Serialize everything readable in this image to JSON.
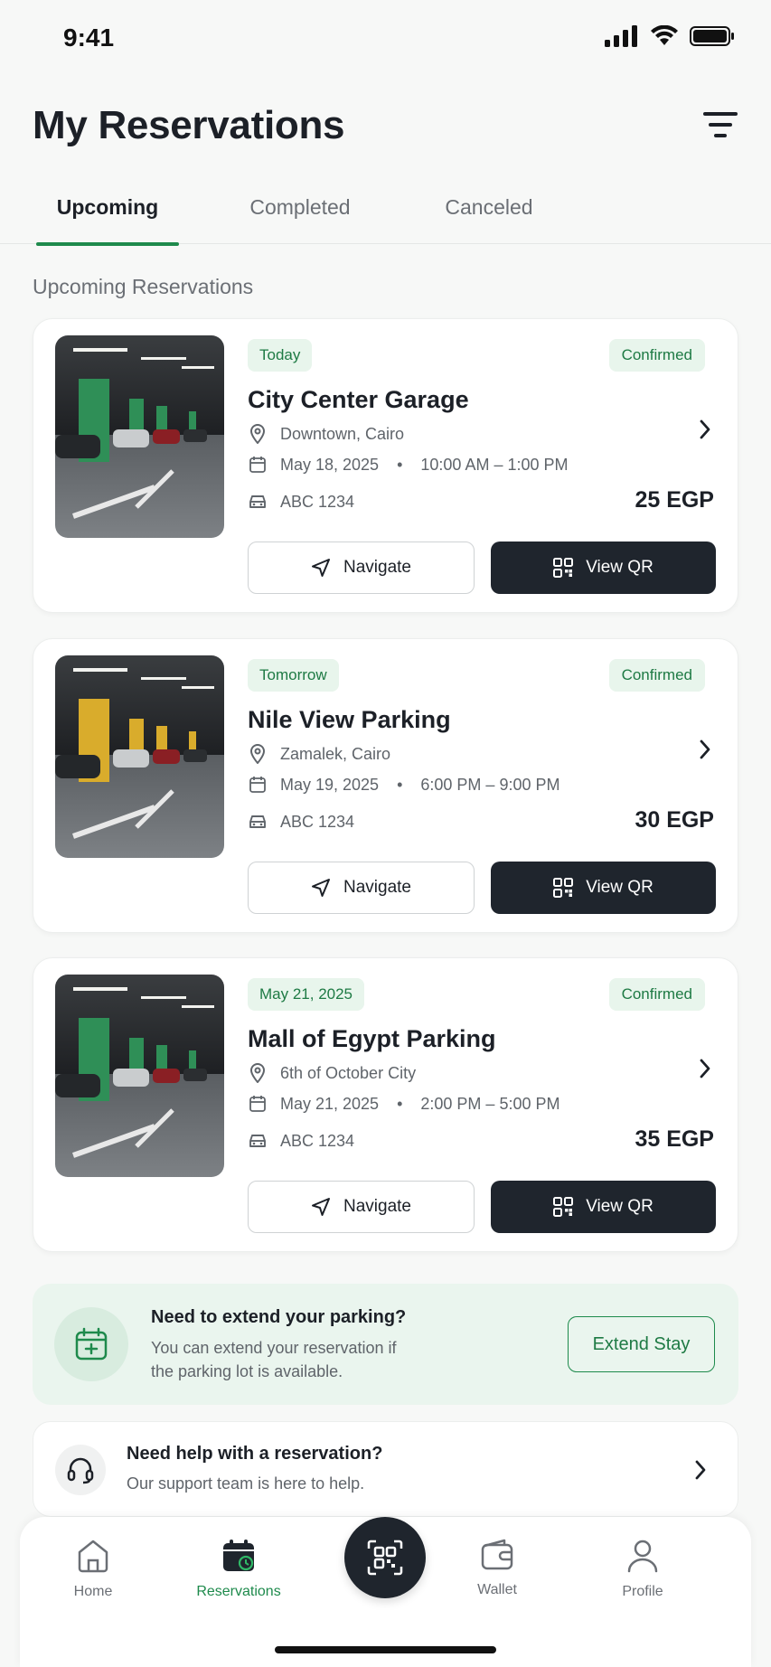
{
  "status_bar": {
    "time": "9:41"
  },
  "header": {
    "title": "My Reservations"
  },
  "tabs": [
    {
      "label": "Upcoming",
      "active": true
    },
    {
      "label": "Completed",
      "active": false
    },
    {
      "label": "Canceled",
      "active": false
    }
  ],
  "section_label": "Upcoming Reservations",
  "reservations": [
    {
      "date_badge": "Today",
      "status": "Confirmed",
      "name": "City Center Garage",
      "location": "Downtown, Cairo",
      "date": "May 18, 2025",
      "time": "10:00 AM – 1:00 PM",
      "plate": "ABC 1234",
      "price": "25 EGP",
      "navigate_label": "Navigate",
      "qr_label": "View QR",
      "pillar_color": "#2f8f57"
    },
    {
      "date_badge": "Tomorrow",
      "status": "Confirmed",
      "name": "Nile View Parking",
      "location": "Zamalek, Cairo",
      "date": "May 19, 2025",
      "time": "6:00 PM – 9:00 PM",
      "plate": "ABC 1234",
      "price": "30 EGP",
      "navigate_label": "Navigate",
      "qr_label": "View QR",
      "pillar_color": "#d9ac2c"
    },
    {
      "date_badge": "May 21, 2025",
      "status": "Confirmed",
      "name": "Mall of Egypt Parking",
      "location": "6th of October City",
      "date": "May 21, 2025",
      "time": "2:00 PM – 5:00 PM",
      "plate": "ABC 1234",
      "price": "35 EGP",
      "navigate_label": "Navigate",
      "qr_label": "View QR",
      "pillar_color": "#2f8f57"
    }
  ],
  "extend": {
    "title": "Need to extend your parking?",
    "text": "You can extend your reservation if the parking lot is available.",
    "button": "Extend Stay"
  },
  "help": {
    "title": "Need help with a reservation?",
    "text": "Our support team is here to help."
  },
  "nav": [
    {
      "label": "Home",
      "icon": "home-icon",
      "active": false
    },
    {
      "label": "Reservations",
      "icon": "calendar-icon",
      "active": true
    },
    {
      "label": "",
      "icon": "qr-scan-icon",
      "active": false
    },
    {
      "label": "Wallet",
      "icon": "wallet-icon",
      "active": false
    },
    {
      "label": "Profile",
      "icon": "profile-icon",
      "active": false
    }
  ],
  "colors": {
    "accent": "#1e8a4c",
    "dark": "#1f252d",
    "badge_bg": "#e8f5ec"
  }
}
